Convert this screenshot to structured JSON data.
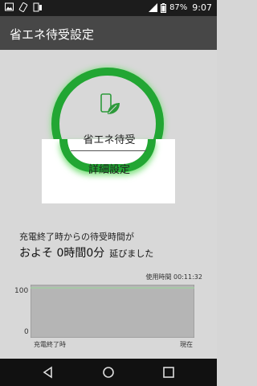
{
  "status": {
    "battery": "87%",
    "time": "9:07"
  },
  "appbar": {
    "title": "省エネ待受設定"
  },
  "ring": {
    "label": "省エネ待受",
    "detail_button": "詳細設定"
  },
  "info": {
    "line1": "充電終了時からの待受時間が",
    "line2_main": "およそ 0時間0分",
    "line2_suffix": "延びました",
    "usage_time": "使用時間 00:11:32"
  },
  "chart_data": {
    "type": "line",
    "title": "",
    "xlabel": "",
    "ylabel": "",
    "x_labels": [
      "充電終了時",
      "現在"
    ],
    "y_ticks": [
      "100",
      "0"
    ],
    "ylim": [
      0,
      100
    ],
    "series": [
      {
        "values": [
          94,
          94,
          94
        ]
      }
    ]
  },
  "nav": {
    "back": "back-icon",
    "home": "home-icon",
    "recents": "recents-icon"
  },
  "colors": {
    "accent": "#22a633",
    "appbar": "#474747",
    "line": "#9fd49f"
  }
}
